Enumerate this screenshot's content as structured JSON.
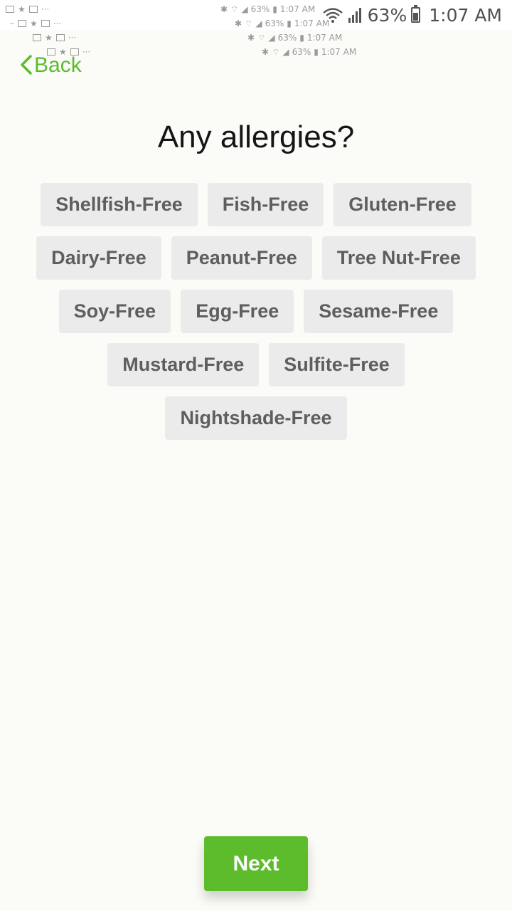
{
  "status_bar": {
    "battery_percent": "63%",
    "time": "1:07 AM",
    "ghost_percent": "63%",
    "ghost_time": "1:07 AM"
  },
  "nav": {
    "back_label": "Back"
  },
  "page": {
    "title": "Any allergies?"
  },
  "chips": [
    [
      "Shellfish-Free",
      "Fish-Free",
      "Gluten-Free"
    ],
    [
      "Dairy-Free",
      "Peanut-Free",
      "Tree Nut-Free"
    ],
    [
      "Soy-Free",
      "Egg-Free",
      "Sesame-Free"
    ],
    [
      "Mustard-Free",
      "Sulfite-Free"
    ],
    [
      "Nightshade-Free"
    ]
  ],
  "footer": {
    "next_label": "Next"
  },
  "colors": {
    "accent": "#5cbc2c",
    "background": "#fbfcf7",
    "chip_bg": "#ebebeb",
    "chip_text": "#5e5e5e"
  }
}
